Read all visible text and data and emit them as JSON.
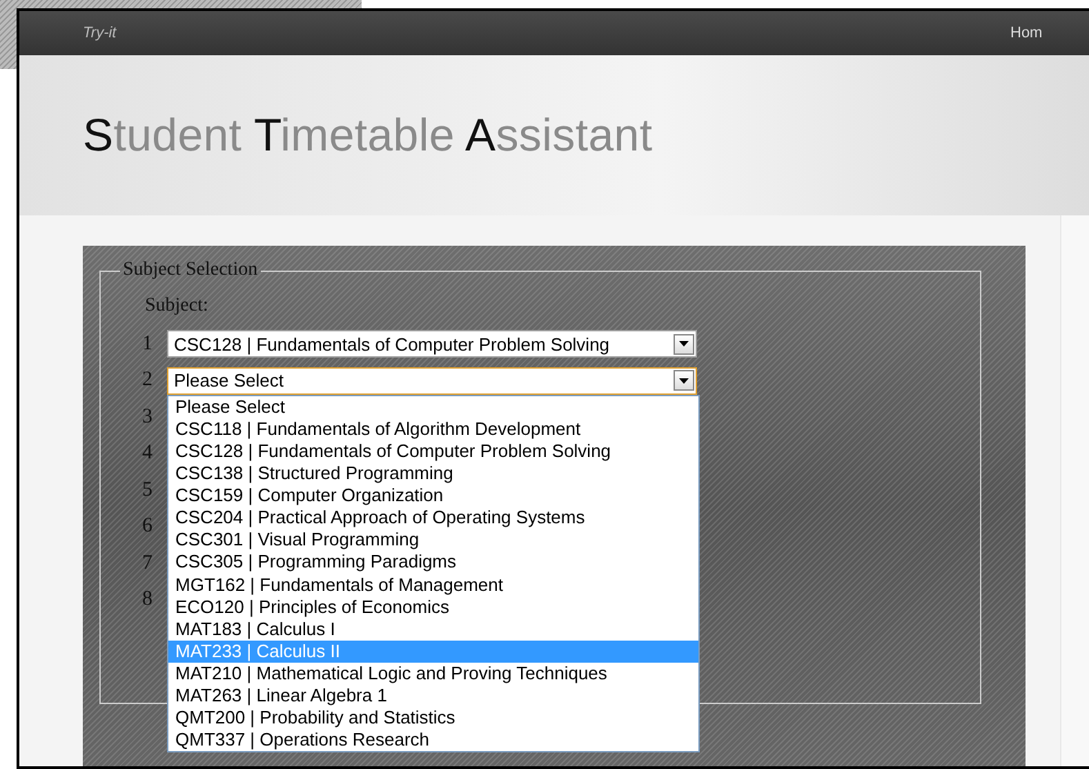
{
  "navbar": {
    "brand": "Try-it",
    "link": "Hom"
  },
  "title": "Student Timetable Assistant",
  "fieldset": {
    "legend": "Subject Selection",
    "label": "Subject:",
    "rows": [
      {
        "number": "1",
        "value": "CSC128 | Fundamentals of Computer Problem Solving",
        "open": false
      },
      {
        "number": "2",
        "value": "Please Select",
        "open": true
      },
      {
        "number": "3"
      },
      {
        "number": "4"
      },
      {
        "number": "5"
      },
      {
        "number": "6"
      },
      {
        "number": "7"
      },
      {
        "number": "8"
      }
    ]
  },
  "options": [
    {
      "label": "Please Select",
      "selected": false
    },
    {
      "label": "CSC118 | Fundamentals of Algorithm Development",
      "selected": false
    },
    {
      "label": "CSC128 | Fundamentals of Computer Problem Solving",
      "selected": false
    },
    {
      "label": "CSC138 | Structured Programming",
      "selected": false
    },
    {
      "label": "CSC159 | Computer Organization",
      "selected": false
    },
    {
      "label": "CSC204 | Practical Approach of Operating Systems",
      "selected": false
    },
    {
      "label": "CSC301 | Visual Programming",
      "selected": false
    },
    {
      "label": "CSC305 | Programming Paradigms",
      "selected": false
    },
    {
      "label": "MGT162 | Fundamentals of Management",
      "selected": false
    },
    {
      "label": "ECO120 | Principles of Economics",
      "selected": false
    },
    {
      "label": "MAT183 | Calculus I",
      "selected": false
    },
    {
      "label": "MAT233 | Calculus II",
      "selected": true
    },
    {
      "label": "MAT210 | Mathematical Logic and Proving Techniques",
      "selected": false
    },
    {
      "label": "MAT263 | Linear Algebra 1",
      "selected": false
    },
    {
      "label": "QMT200 | Probability and Statistics",
      "selected": false
    },
    {
      "label": "QMT337 | Operations Research",
      "selected": false
    }
  ]
}
